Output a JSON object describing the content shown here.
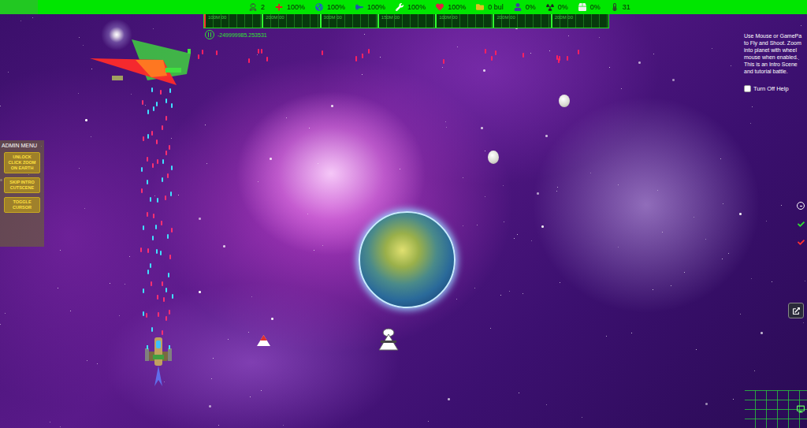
{
  "hud": {
    "stats": [
      {
        "value": "2"
      },
      {
        "value": "100%"
      },
      {
        "value": "100%"
      },
      {
        "value": "100%"
      },
      {
        "value": "100%"
      },
      {
        "value": "100%"
      },
      {
        "value": "0 bul"
      },
      {
        "value": "0%"
      },
      {
        "value": "0%"
      },
      {
        "value": "0%"
      },
      {
        "value": "31"
      }
    ],
    "ruler_labels": [
      "100M 00",
      "200M 00",
      "300M 00",
      "150M 00",
      "100M 00",
      "200M 00",
      "200M 00"
    ],
    "coordinate": "-249999985.253531"
  },
  "admin_menu": {
    "title": "ADMIN MENU",
    "buttons": [
      "UNLOCK CLICK ZOOM ON EARTH",
      "SKIP INTRO CUTSCENE",
      "TOGGLE CURSOR"
    ]
  },
  "help": {
    "lines": [
      "Use Mouse or GamePa",
      "to Fly and Shoot. Zoom",
      "into planet with wheel",
      "mouse when enabled.",
      "This is an Intro Scene",
      "and tutorial battle."
    ],
    "checkbox": {
      "label": "Turn Off Help",
      "checked": false
    }
  }
}
